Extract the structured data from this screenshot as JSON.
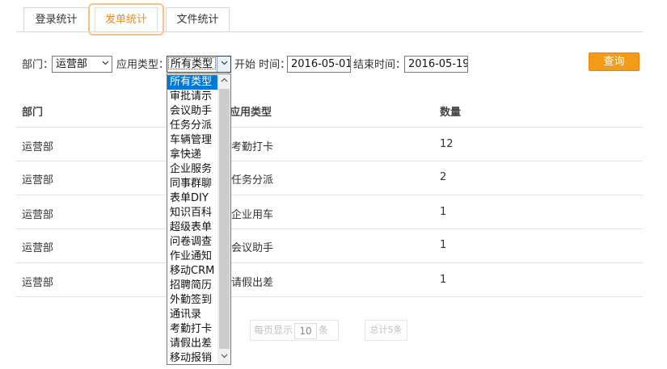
{
  "tabs": [
    {
      "label": "登录统计",
      "active": false
    },
    {
      "label": "发单统计",
      "active": true
    },
    {
      "label": "文件统计",
      "active": false
    }
  ],
  "filters": {
    "department_label": "部门：",
    "department_value": "运营部",
    "app_type_label": "应用类型：",
    "app_type_value": "所有类型",
    "start_label": "开始 时间：",
    "start_date": "2016-05-01",
    "end_label": "结束时间：",
    "end_date": "2016-05-19",
    "query_label": "查询"
  },
  "table": {
    "headers": [
      "部门",
      "应用类型",
      "数量"
    ],
    "rows": [
      [
        "运营部",
        "考勤打卡",
        "12"
      ],
      [
        "运营部",
        "任务分派",
        "2"
      ],
      [
        "运营部",
        "企业用车",
        "1"
      ],
      [
        "运营部",
        "会议助手",
        "1"
      ],
      [
        "运营部",
        "请假出差",
        "1"
      ]
    ]
  },
  "pager": {
    "per_page_prefix": "每页显示",
    "per_page_value": "10",
    "per_page_suffix": "条",
    "total_label": "总计5条"
  },
  "dropdown": {
    "options": [
      "所有类型",
      "审批请示",
      "会议助手",
      "任务分派",
      "车辆管理",
      "拿快递",
      "企业服务",
      "同事群聊",
      "表单DIY",
      "知识百科",
      "超级表单",
      "问卷调查",
      "作业通知",
      "移动CRM",
      "招聘简历",
      "外勤签到",
      "通讯录",
      "考勤打卡",
      "请假出差",
      "移动报销"
    ],
    "selected_index": 0
  },
  "colors": {
    "accent": "#f08c1c",
    "query_button": "#f49b1a",
    "dropdown_selected": "#0078d7"
  },
  "icons": {
    "select_arrow": "chevron-down-icon",
    "scroll_up": "chevron-up-icon",
    "scroll_down": "chevron-down-icon"
  }
}
